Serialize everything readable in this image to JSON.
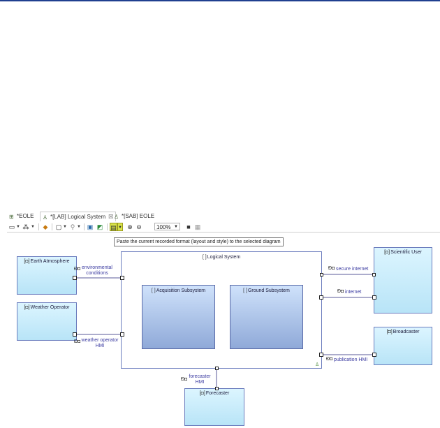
{
  "tabs": [
    {
      "label": "*EOLE",
      "icon": "project-icon"
    },
    {
      "label": "*[LAB] Logical System",
      "icon": "diagram-icon",
      "close": "☒"
    },
    {
      "label": "*[SAB] EOLE",
      "icon": "diagram-icon"
    }
  ],
  "toolbar": {
    "zoom": "100%",
    "tooltip": "Paste the current recorded format (layout and style) to the selected diagram"
  },
  "diagram": {
    "actors": {
      "earth": "Earth Atmosphere",
      "weather": "Weather Operator",
      "scientific": "Scientific User",
      "broadcaster": "Broadcaster",
      "forecaster": "Forecaster"
    },
    "system": "Logical System",
    "subsystems": {
      "acquisition": "Acquisition Subsystem",
      "ground": "Ground Subsystem"
    },
    "exchanges": {
      "env_1": "environmental",
      "env_2": "conditions",
      "whmi_1": "weather operator",
      "whmi_2": "HMI",
      "secure": "secure internet",
      "internet": "internet",
      "publication": "publication HMI",
      "fhmi_1": "forecaster",
      "fhmi_2": "HMI"
    }
  },
  "colors": {
    "actor_fill": "#c8ecfb",
    "subsystem_fill": "#a9c0e6",
    "border": "#6a7bbd",
    "highlight": "#d8e34a"
  }
}
